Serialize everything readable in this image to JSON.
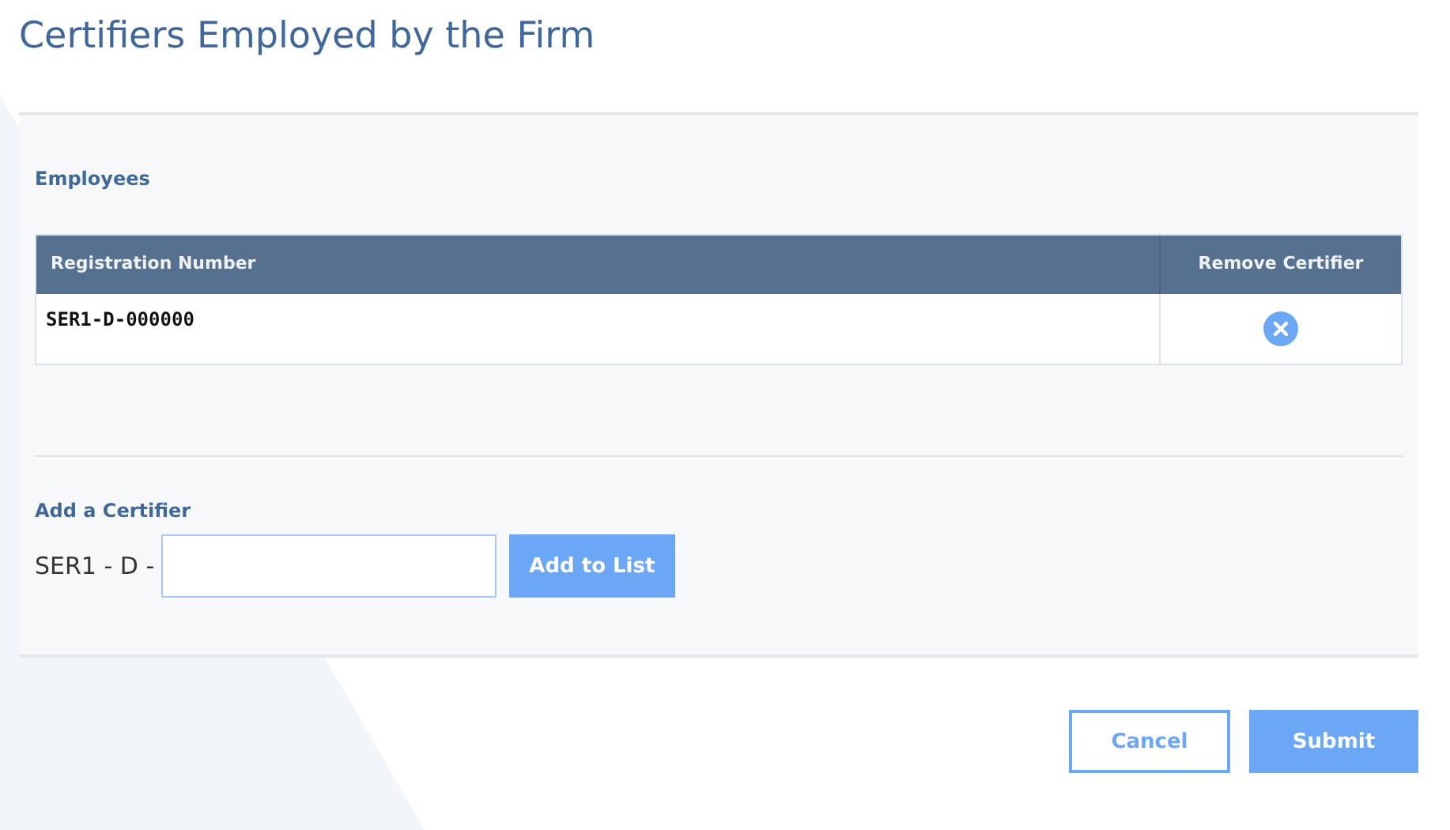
{
  "title": "Certifiers Employed by the Firm",
  "employees": {
    "label": "Employees",
    "columns": [
      "Registration Number",
      "Remove Certifier"
    ],
    "rows": [
      {
        "registration_number": "SER1-D-000000"
      }
    ]
  },
  "add": {
    "label": "Add a Certifier",
    "prefix": "SER1 - D -",
    "button": "Add to List"
  },
  "buttons": [
    {
      "label": "Cancel",
      "kind": "secondary"
    },
    {
      "label": "Submit",
      "kind": "primary"
    }
  ]
}
